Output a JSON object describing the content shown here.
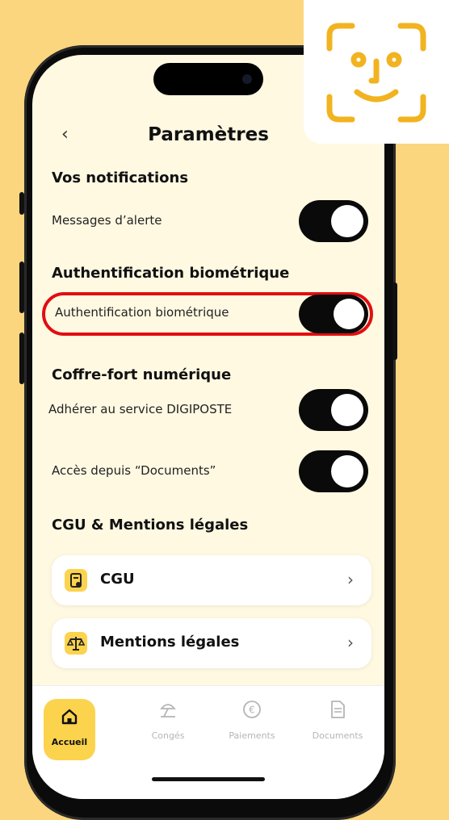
{
  "header": {
    "title": "Paramètres",
    "back_icon": "‹"
  },
  "sections": {
    "notifications": {
      "title": "Vos notifications",
      "alert_label": "Messages d’alerte"
    },
    "biometric": {
      "title": "Authentification biométrique",
      "toggle_label": "Authentification biométrique"
    },
    "vault": {
      "title": "Coffre-fort numérique",
      "digiposte_label": "Adhérer au service DIGIPOSTE",
      "documents_label": "Accès depuis “Documents”"
    },
    "legal": {
      "title": "CGU & Mentions légales"
    }
  },
  "cards": [
    {
      "label": "CGU",
      "icon": "document-icon",
      "chevron": "›"
    },
    {
      "label": "Mentions légales",
      "icon": "scales-icon",
      "chevron": "›"
    }
  ],
  "tabs": [
    {
      "label": "Accueil",
      "icon": "home-icon",
      "active": true
    },
    {
      "label": "Congés",
      "icon": "beach-icon",
      "active": false
    },
    {
      "label": "Paiements",
      "icon": "euro-icon",
      "active": false
    },
    {
      "label": "Documents",
      "icon": "file-icon",
      "active": false
    }
  ],
  "toggles": {
    "alert": true,
    "biometric": true,
    "digiposte": true,
    "documents": true
  },
  "colors": {
    "background": "#FCD67E",
    "accent": "#FCD34D",
    "highlight": "#E10E12",
    "screen": "#FFF9E2",
    "faceid": "#F2B320"
  },
  "overlay": {
    "icon": "face-id-icon"
  }
}
